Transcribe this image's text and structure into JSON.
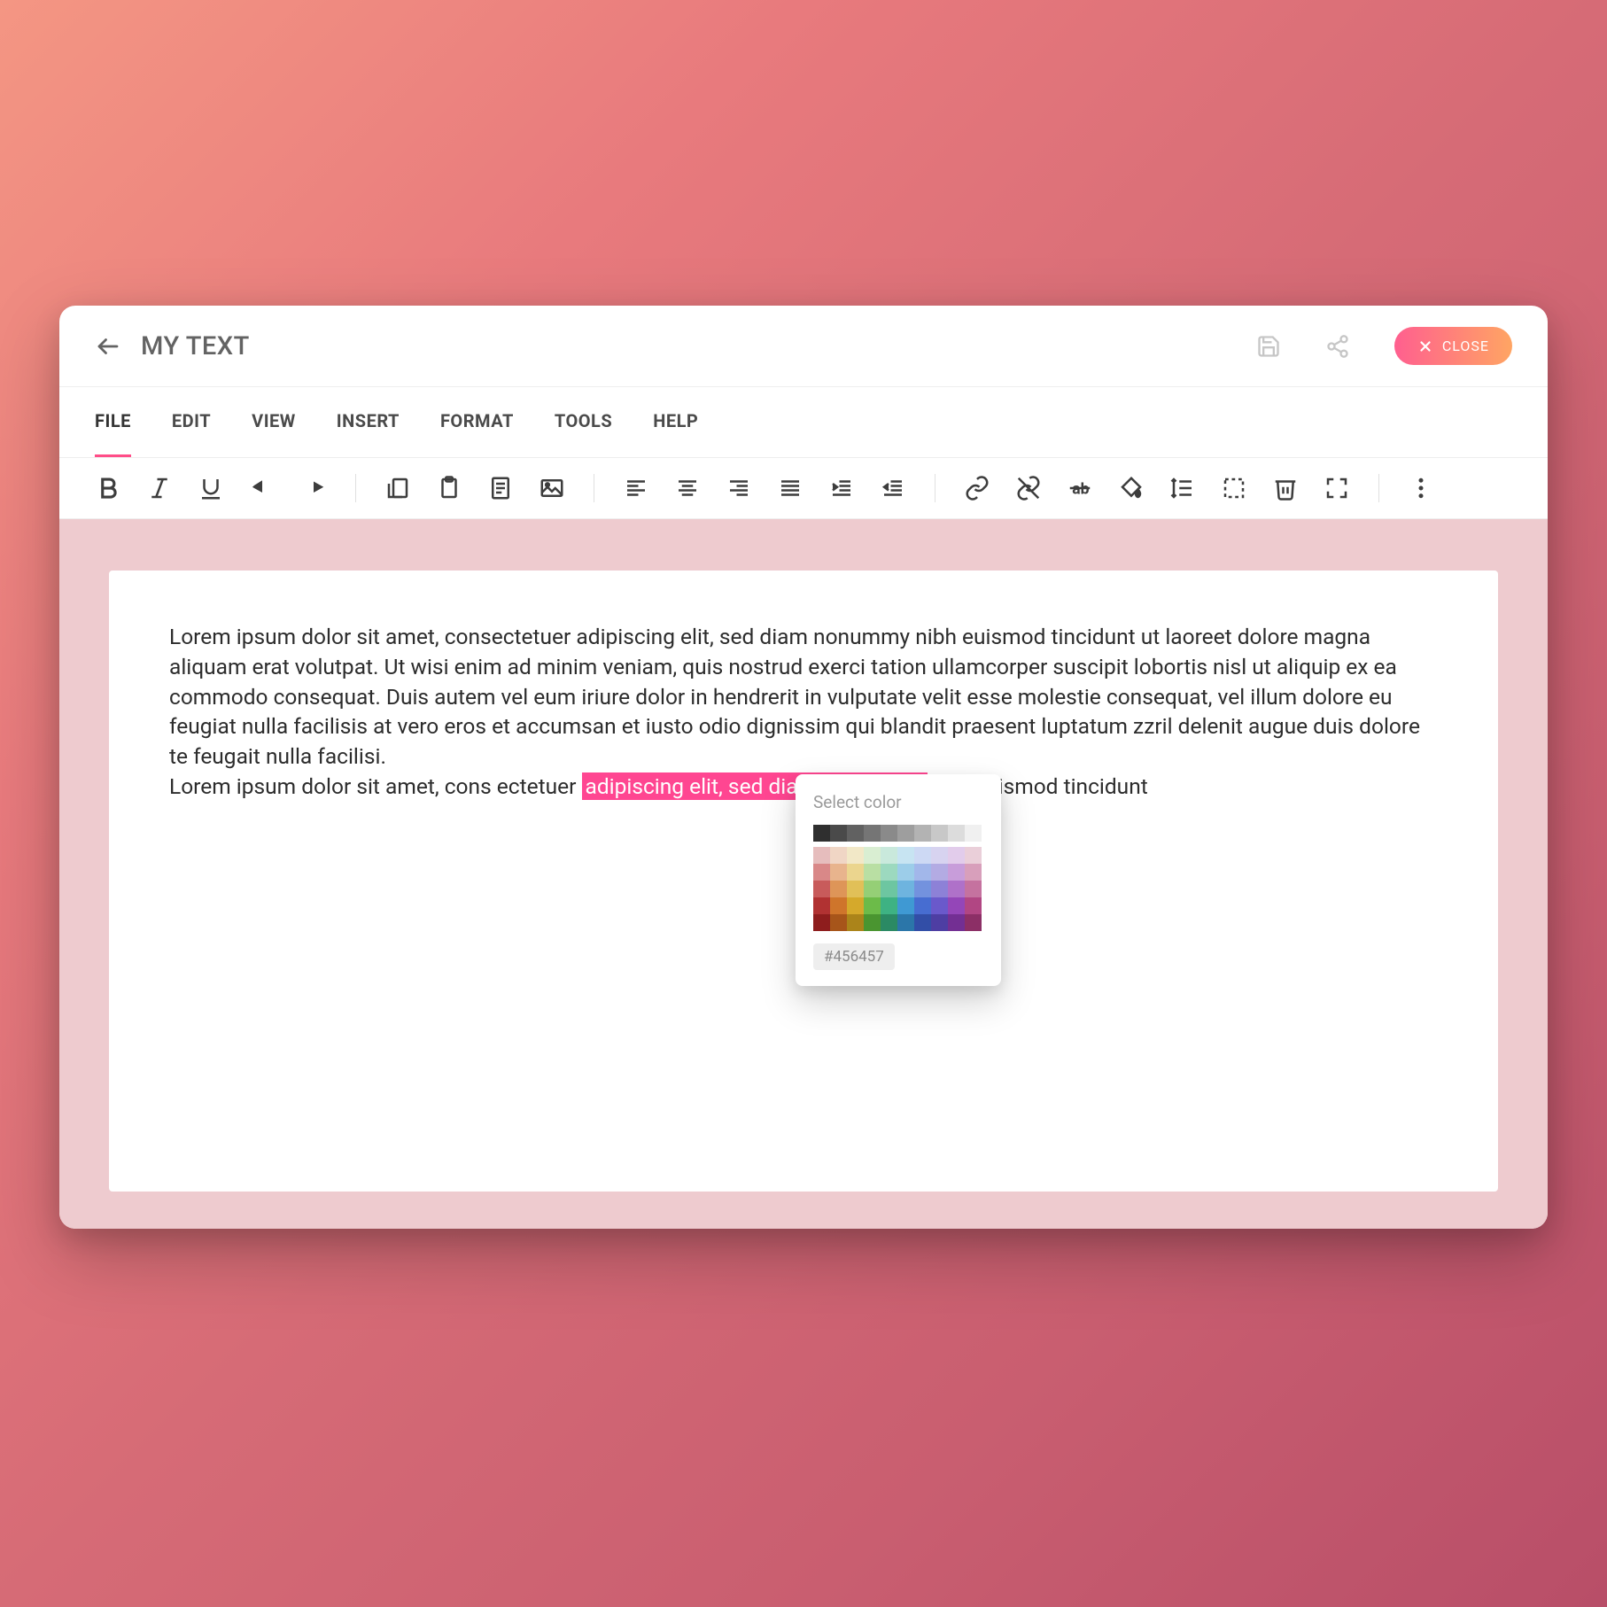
{
  "header": {
    "title": "MY TEXT",
    "close_label": "CLOSE"
  },
  "menu": [
    {
      "label": "FILE",
      "active": true
    },
    {
      "label": "EDIT",
      "active": false
    },
    {
      "label": "VIEW",
      "active": false
    },
    {
      "label": "INSERT",
      "active": false
    },
    {
      "label": "FORMAT",
      "active": false
    },
    {
      "label": "TOOLS",
      "active": false
    },
    {
      "label": "HELP",
      "active": false
    }
  ],
  "document": {
    "p1": "Lorem ipsum dolor sit amet, consectetuer adipiscing elit, sed diam nonummy nibh euismod tincidunt ut laoreet dolore magna aliquam erat volutpat. Ut wisi enim ad minim veniam, quis nostrud exerci tation ullamcorper suscipit lobortis nisl ut aliquip ex ea commodo consequat. Duis autem vel eum iriure dolor in hendrerit in vulputate velit esse molestie consequat, vel illum dolore eu feugiat nulla facilisis at vero eros et accumsan et iusto odio dignissim qui blandit praesent luptatum zzril delenit augue duis dolore te feugait nulla facilisi.",
    "p2_before": "Lorem ipsum dolor sit amet, cons ectetuer ",
    "p2_highlight": "adipiscing elit, sed diam nonummy ",
    "p2_after": "nibh euismod tincidunt"
  },
  "color_picker": {
    "title": "Select color",
    "hex_value": "#456457",
    "gray_row": [
      "#2f2f2f",
      "#4a4a4a",
      "#616161",
      "#757575",
      "#8a8a8a",
      "#9e9e9e",
      "#b3b3b3",
      "#c8c8c8",
      "#dcdcdc",
      "#f0f0f0"
    ],
    "palette": [
      [
        "#e6bdbd",
        "#f0d6c5",
        "#f2e8c7",
        "#d9eed2",
        "#c9e9dc",
        "#c7e4f2",
        "#cdd9f4",
        "#d7d3f0",
        "#e2cceb",
        "#eacfd9"
      ],
      [
        "#d98888",
        "#e8b48d",
        "#ebd58e",
        "#b9dfa3",
        "#9cd9bf",
        "#9ccde9",
        "#a2b7ea",
        "#b3abe3",
        "#c89dda",
        "#d89fbb"
      ],
      [
        "#c85b5b",
        "#de9558",
        "#e1c058",
        "#95cf76",
        "#6dc6a1",
        "#6eb4df",
        "#7392de",
        "#8d81d7",
        "#af71c9",
        "#c5729f"
      ],
      [
        "#b13232",
        "#cf752b",
        "#d5a92b",
        "#6cbb49",
        "#3eb283",
        "#3f99d3",
        "#476dd1",
        "#6a59cb",
        "#9446b8",
        "#b14683"
      ],
      [
        "#8e1d1d",
        "#a7551a",
        "#ab841a",
        "#4a9530",
        "#2b8a64",
        "#2b76a9",
        "#324ea7",
        "#4e3ea3",
        "#732f93",
        "#8c2f66"
      ]
    ]
  }
}
